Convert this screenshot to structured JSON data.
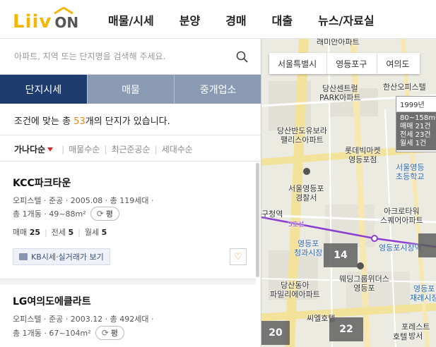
{
  "header": {
    "logo_liiv": "Liiv",
    "logo_on": "ON",
    "nav": [
      "매물/시세",
      "분양",
      "경매",
      "대출",
      "뉴스/자료실"
    ]
  },
  "search": {
    "placeholder": "아파트, 지역 또는 단지명을 검색해 주세요."
  },
  "tabs": [
    "단지시세",
    "매물",
    "중개업소"
  ],
  "summary": {
    "prefix": "조건에 맞는 총 ",
    "count": "53",
    "suffix": "개의 단지가 있습니다."
  },
  "sort": {
    "options": [
      "가나다순",
      "매물수순",
      "최근준공순",
      "세대수순"
    ]
  },
  "listings": [
    {
      "name": "KCC파크타운",
      "info": "오피스텔 · 준공 · 2005.08 · 총 119세대 ·",
      "area": "총 1개동 · 49~88m²",
      "pyeong": "평",
      "sale_label": "매매",
      "sale": "25",
      "jeonse_label": "전세",
      "jeonse": "5",
      "monthly_label": "월세",
      "monthly": "5",
      "kb_button": "KB시세·실거래가 보기"
    },
    {
      "name": "LG여의도에클라트",
      "info": "오피스텔 · 준공 · 2003.12 · 총 492세대 ·",
      "area": "총 1개동 · 67~104m²",
      "pyeong": "평"
    }
  ],
  "map": {
    "breadcrumb": [
      "서울특별시",
      "영등포구",
      "여의도"
    ],
    "info_box": {
      "year": "1999년",
      "area": "80~158m²",
      "sale": "매매 21건",
      "jeonse": "전세 23건",
      "monthly": "월세 1건"
    },
    "clusters": [
      "14",
      "20",
      "22"
    ],
    "labels": {
      "l1": "래미안아파트",
      "l2": "당산센트럴\nPARK아파트",
      "l3": "한산오피스텔",
      "l4": "당산반도유보라\n팰리스아파트",
      "l5": "롯데빅마켓\n영등포점",
      "l6": "서울영등\n초등학교",
      "l7": "서울영등포\n경찰서",
      "l8": "구청역",
      "l9": "아크로타워\n스퀘어아파트",
      "l10": "5호선",
      "l11": "영등포\n청과시장",
      "l12": "영등포시장역",
      "l13": "웨딩그룹위더스\n영등포",
      "l14": "당산동아\n파밀리에아파트",
      "l15": "영등포\n재래시장",
      "l16": "씨엘호텔",
      "l17": "포레스트\n방서",
      "l18": "호텔"
    }
  }
}
